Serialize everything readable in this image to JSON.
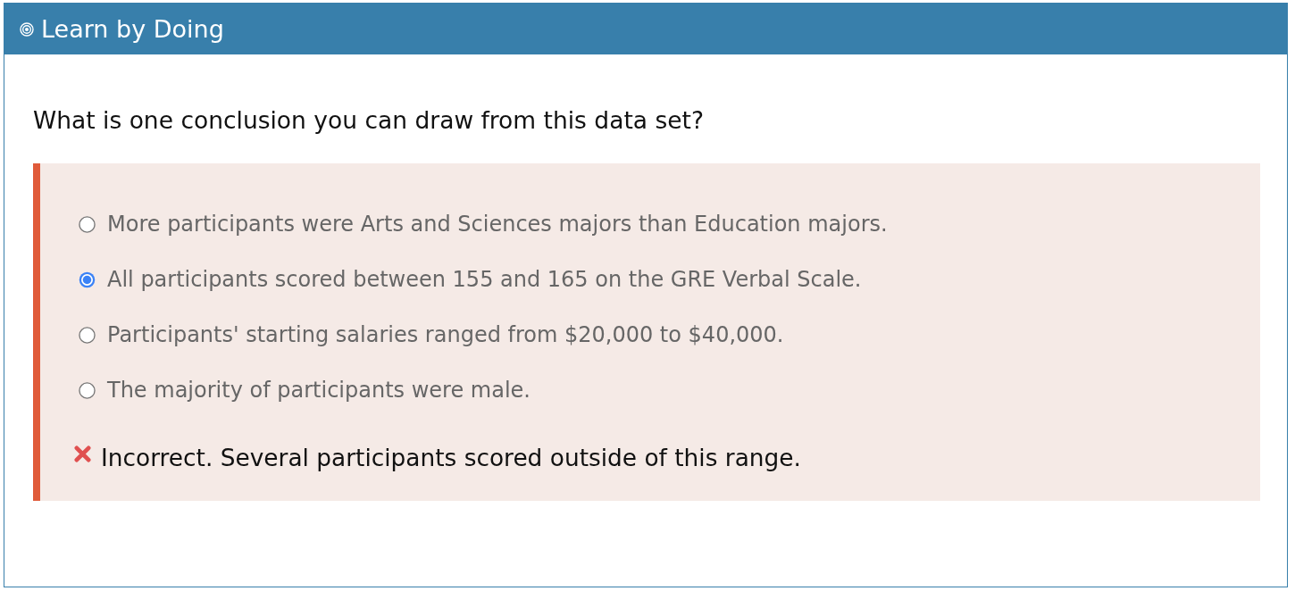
{
  "header": {
    "title": "Learn by Doing"
  },
  "question": {
    "prompt": "What is one conclusion you can draw from this data set?"
  },
  "options": [
    {
      "label": "More participants were Arts and Sciences majors than Education majors.",
      "selected": false
    },
    {
      "label": "All participants scored between 155 and 165 on the GRE Verbal Scale.",
      "selected": true
    },
    {
      "label": "Participants' starting salaries ranged from $20,000 to $40,000.",
      "selected": false
    },
    {
      "label": "The majority of participants were male.",
      "selected": false
    }
  ],
  "feedback": {
    "kind": "incorrect",
    "text": "Incorrect. Several participants scored outside of this range."
  }
}
